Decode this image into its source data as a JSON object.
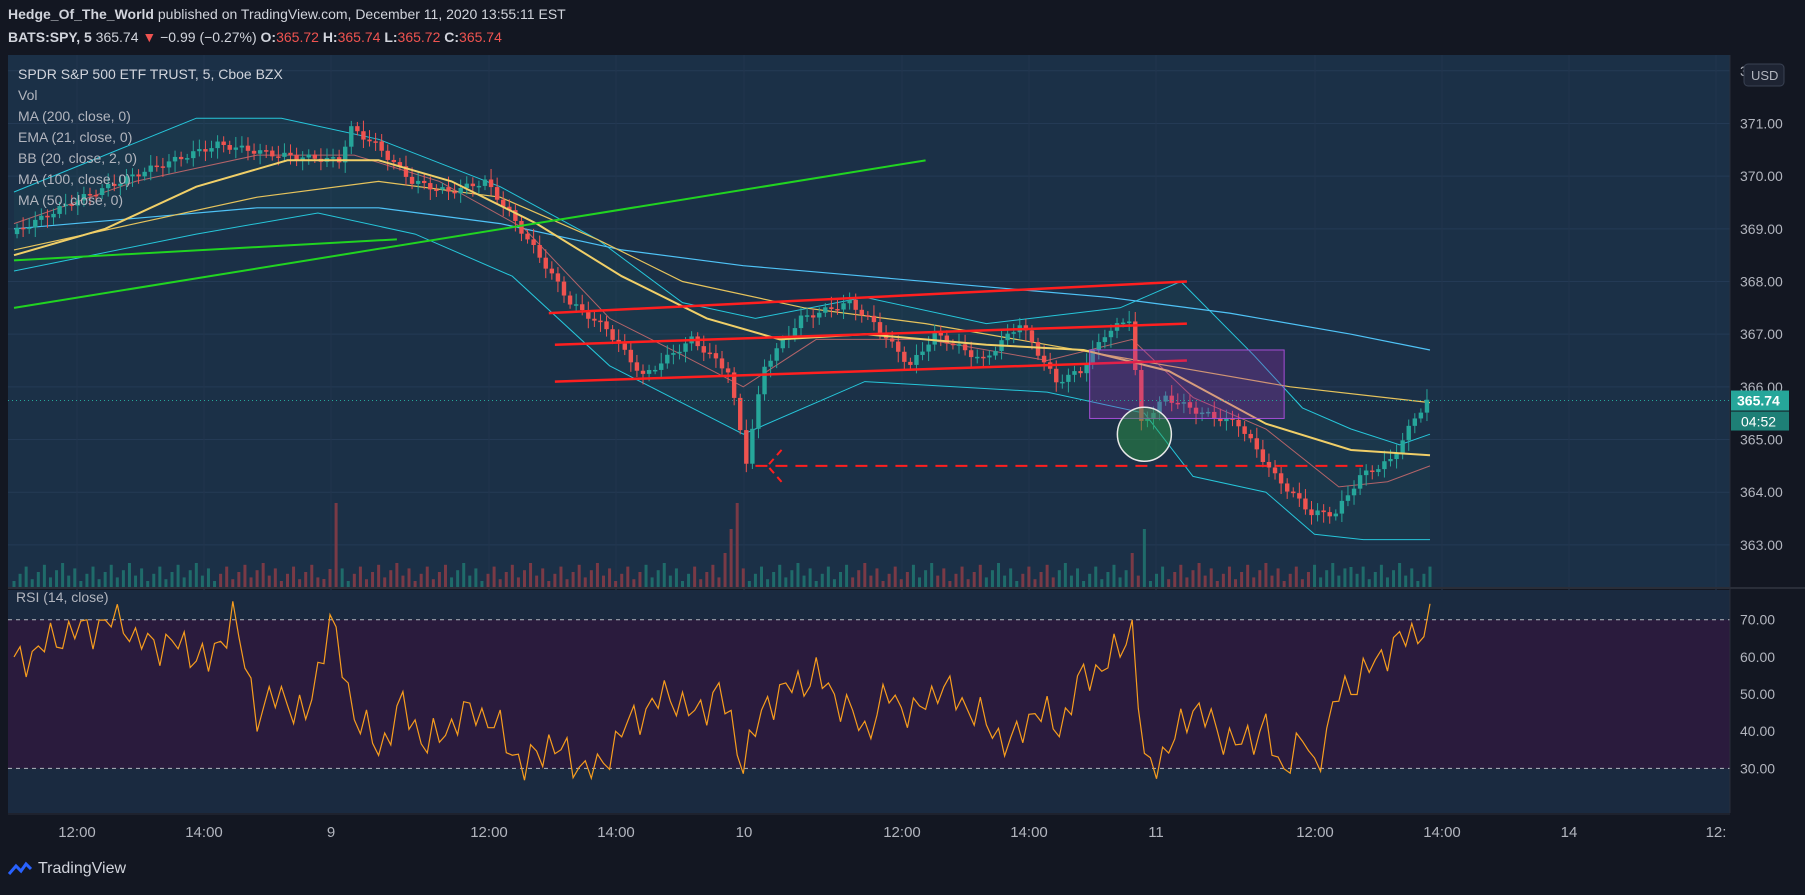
{
  "header": {
    "author": "Hedge_Of_The_World",
    "published_text": "published on TradingView.com, December 11, 2020 13:55:11 EST",
    "symbol": "BATS:SPY, 5",
    "last": "365.74",
    "change_arrow": "▼",
    "change": "−0.99 (−0.27%)",
    "o_label": "O:",
    "o_value": "365.72",
    "h_label": "H:",
    "h_value": "365.74",
    "l_label": "L:",
    "l_value": "365.72",
    "c_label": "C:",
    "c_value": "365.74"
  },
  "legend": [
    "SPDR S&P 500 ETF TRUST, 5, Cboe BZX",
    "Vol",
    "MA (200, close, 0)",
    "EMA (21, close, 0)",
    "BB (20, close, 2, 0)",
    "MA (100, close, 0)",
    "MA (50, close, 0)"
  ],
  "currency_button": "USD",
  "price_axis": [
    "372.00",
    "371.00",
    "370.00",
    "369.00",
    "368.00",
    "367.00",
    "366.00",
    "365.00",
    "364.00",
    "363.00"
  ],
  "last_price_label": "365.74",
  "countdown_label": "04:52",
  "rsi_label": "RSI (14, close)",
  "rsi_axis": [
    "70.00",
    "60.00",
    "50.00",
    "40.00",
    "30.00"
  ],
  "time_axis": [
    "12:00",
    "14:00",
    "9",
    "12:00",
    "14:00",
    "10",
    "12:00",
    "14:00",
    "11",
    "12:00",
    "14:00",
    "14",
    "12:"
  ],
  "footer_brand": "TradingView",
  "colors": {
    "background": "#131722",
    "pane": "#1b3047",
    "rsi_band": "#2a1b3d",
    "up": "#26a69a",
    "down": "#ef5350",
    "ma200": "#4fc3f7",
    "ma100": "#e6c35c",
    "ma50": "#f0cf68",
    "ema21": "#e57373",
    "bb": "#26c6da",
    "trend_green": "#21d421",
    "trend_red": "#ff1f1f",
    "rsi": "#f79d1e",
    "box": "#a64dd6"
  },
  "chart_data": [
    {
      "type": "candlestick",
      "title": "SPDR S&P 500 ETF TRUST, 5, Cboe BZX",
      "ylim": [
        362.2,
        372.3
      ],
      "y_ticks": [
        363,
        364,
        365,
        366,
        367,
        368,
        369,
        370,
        371,
        372
      ],
      "x_range": [
        0,
        233
      ],
      "last": 365.74,
      "anchors": [
        [
          0,
          368.9
        ],
        [
          10,
          369.5
        ],
        [
          22,
          370.1
        ],
        [
          34,
          370.6
        ],
        [
          44,
          370.4
        ],
        [
          54,
          370.3
        ],
        [
          56,
          370.9
        ],
        [
          60,
          370.6
        ],
        [
          66,
          369.9
        ],
        [
          72,
          369.7
        ],
        [
          78,
          369.9
        ],
        [
          82,
          369.3
        ],
        [
          88,
          368.3
        ],
        [
          92,
          367.6
        ],
        [
          98,
          367.1
        ],
        [
          104,
          366.2
        ],
        [
          112,
          366.9
        ],
        [
          118,
          366.3
        ],
        [
          121,
          364.6
        ],
        [
          124,
          366.4
        ],
        [
          130,
          367.3
        ],
        [
          138,
          367.6
        ],
        [
          142,
          367.2
        ],
        [
          148,
          366.4
        ],
        [
          152,
          367.0
        ],
        [
          160,
          366.5
        ],
        [
          166,
          367.2
        ],
        [
          172,
          366.1
        ],
        [
          176,
          366.3
        ],
        [
          180,
          367.0
        ],
        [
          184,
          367.3
        ],
        [
          186,
          365.3
        ],
        [
          190,
          365.8
        ],
        [
          196,
          365.5
        ],
        [
          202,
          365.3
        ],
        [
          208,
          364.3
        ],
        [
          214,
          363.6
        ],
        [
          218,
          363.6
        ],
        [
          222,
          364.3
        ],
        [
          227,
          364.6
        ],
        [
          231,
          365.4
        ],
        [
          233,
          365.74
        ]
      ],
      "bollinger": {
        "upper": [
          [
            0,
            369.7
          ],
          [
            30,
            371.1
          ],
          [
            44,
            371.1
          ],
          [
            60,
            370.7
          ],
          [
            80,
            369.8
          ],
          [
            96,
            368.8
          ],
          [
            110,
            367.6
          ],
          [
            122,
            367.3
          ],
          [
            140,
            367.7
          ],
          [
            160,
            367.2
          ],
          [
            182,
            367.5
          ],
          [
            192,
            368.0
          ],
          [
            204,
            366.6
          ],
          [
            212,
            365.6
          ],
          [
            220,
            365.2
          ],
          [
            228,
            364.9
          ],
          [
            233,
            365.1
          ]
        ],
        "lower": [
          [
            0,
            368.2
          ],
          [
            30,
            368.9
          ],
          [
            50,
            369.3
          ],
          [
            66,
            368.9
          ],
          [
            82,
            368.1
          ],
          [
            98,
            366.4
          ],
          [
            120,
            365.1
          ],
          [
            140,
            366.1
          ],
          [
            170,
            365.9
          ],
          [
            186,
            365.5
          ],
          [
            194,
            364.3
          ],
          [
            206,
            364.0
          ],
          [
            214,
            363.2
          ],
          [
            222,
            363.1
          ],
          [
            233,
            363.1
          ]
        ]
      },
      "moving_averages": {
        "ma200": [
          [
            0,
            369.0
          ],
          [
            20,
            369.2
          ],
          [
            40,
            369.4
          ],
          [
            60,
            369.4
          ],
          [
            80,
            369.1
          ],
          [
            100,
            368.6
          ],
          [
            120,
            368.3
          ],
          [
            140,
            368.1
          ],
          [
            160,
            367.9
          ],
          [
            180,
            367.7
          ],
          [
            200,
            367.4
          ],
          [
            220,
            367.0
          ],
          [
            233,
            366.7
          ]
        ],
        "ma100": [
          [
            0,
            368.6
          ],
          [
            20,
            369.1
          ],
          [
            40,
            369.6
          ],
          [
            60,
            369.9
          ],
          [
            80,
            369.6
          ],
          [
            96,
            368.8
          ],
          [
            110,
            368.0
          ],
          [
            130,
            367.5
          ],
          [
            150,
            367.2
          ],
          [
            170,
            366.8
          ],
          [
            190,
            366.4
          ],
          [
            210,
            366.0
          ],
          [
            233,
            365.7
          ]
        ],
        "ma50": [
          [
            0,
            368.5
          ],
          [
            15,
            369.0
          ],
          [
            30,
            369.8
          ],
          [
            45,
            370.3
          ],
          [
            60,
            370.3
          ],
          [
            72,
            369.9
          ],
          [
            86,
            369.1
          ],
          [
            100,
            368.1
          ],
          [
            114,
            367.3
          ],
          [
            126,
            366.9
          ],
          [
            140,
            367.0
          ],
          [
            160,
            366.8
          ],
          [
            176,
            366.7
          ],
          [
            190,
            366.3
          ],
          [
            206,
            365.3
          ],
          [
            220,
            364.8
          ],
          [
            233,
            364.7
          ]
        ],
        "ema21": [
          [
            0,
            369.1
          ],
          [
            20,
            369.9
          ],
          [
            40,
            370.4
          ],
          [
            56,
            370.4
          ],
          [
            70,
            369.9
          ],
          [
            84,
            369.0
          ],
          [
            98,
            367.3
          ],
          [
            110,
            366.6
          ],
          [
            120,
            366.0
          ],
          [
            132,
            366.9
          ],
          [
            150,
            366.9
          ],
          [
            170,
            366.5
          ],
          [
            184,
            366.9
          ],
          [
            194,
            365.8
          ],
          [
            206,
            365.2
          ],
          [
            218,
            364.1
          ],
          [
            226,
            364.2
          ],
          [
            233,
            364.5
          ]
        ]
      },
      "volume": {
        "baseline": [
          6,
          24
        ],
        "spikes": [
          [
            51,
            8
          ],
          [
            52,
            18
          ],
          [
            53,
            84
          ],
          [
            117,
            34
          ],
          [
            118,
            58
          ],
          [
            119,
            84
          ],
          [
            184,
            34
          ],
          [
            186,
            58
          ],
          [
            220,
            20
          ]
        ]
      },
      "annotations": {
        "green_trendlines": [
          [
            [
              0,
              368.4
            ],
            [
              63,
              368.8
            ]
          ],
          [
            [
              0,
              367.5
            ],
            [
              150,
              370.3
            ]
          ]
        ],
        "red_channel": [
          [
            [
              88,
              367.4
            ],
            [
              193,
              368.0
            ]
          ],
          [
            [
              89,
              366.8
            ],
            [
              193,
              367.2
            ]
          ],
          [
            [
              89,
              366.1
            ],
            [
              193,
              366.5
            ]
          ]
        ],
        "red_dashed_support": [
          [
            122,
            364.5
          ],
          [
            222,
            364.5
          ]
        ],
        "arrow_at": [
          124,
          364.5
        ],
        "box": [
          [
            177,
            365.4
          ],
          [
            209,
            366.7
          ]
        ],
        "circle_at": [
          186,
          365.1
        ]
      }
    },
    {
      "type": "line",
      "title": "RSI (14, close)",
      "ylim": [
        18,
        78
      ],
      "y_ticks": [
        30,
        40,
        50,
        60,
        70
      ],
      "bands": [
        30,
        70
      ],
      "anchors": [
        [
          0,
          58
        ],
        [
          8,
          66
        ],
        [
          18,
          70
        ],
        [
          20,
          64
        ],
        [
          28,
          63
        ],
        [
          32,
          58
        ],
        [
          36,
          71
        ],
        [
          40,
          45
        ],
        [
          44,
          50
        ],
        [
          48,
          43
        ],
        [
          52,
          70
        ],
        [
          56,
          45
        ],
        [
          60,
          35
        ],
        [
          64,
          47
        ],
        [
          68,
          36
        ],
        [
          72,
          42
        ],
        [
          76,
          46
        ],
        [
          80,
          40
        ],
        [
          84,
          30
        ],
        [
          88,
          37
        ],
        [
          92,
          32
        ],
        [
          96,
          29
        ],
        [
          100,
          40
        ],
        [
          104,
          46
        ],
        [
          108,
          50
        ],
        [
          112,
          44
        ],
        [
          116,
          51
        ],
        [
          120,
          32
        ],
        [
          124,
          48
        ],
        [
          128,
          52
        ],
        [
          132,
          55
        ],
        [
          136,
          48
        ],
        [
          140,
          40
        ],
        [
          144,
          50
        ],
        [
          148,
          44
        ],
        [
          152,
          52
        ],
        [
          156,
          48
        ],
        [
          160,
          42
        ],
        [
          164,
          36
        ],
        [
          168,
          46
        ],
        [
          172,
          41
        ],
        [
          176,
          55
        ],
        [
          180,
          58
        ],
        [
          184,
          68
        ],
        [
          186,
          30
        ],
        [
          190,
          35
        ],
        [
          194,
          47
        ],
        [
          198,
          40
        ],
        [
          202,
          36
        ],
        [
          206,
          42
        ],
        [
          208,
          29
        ],
        [
          212,
          38
        ],
        [
          214,
          30
        ],
        [
          218,
          50
        ],
        [
          222,
          55
        ],
        [
          226,
          62
        ],
        [
          230,
          66
        ],
        [
          233,
          69
        ]
      ]
    }
  ]
}
